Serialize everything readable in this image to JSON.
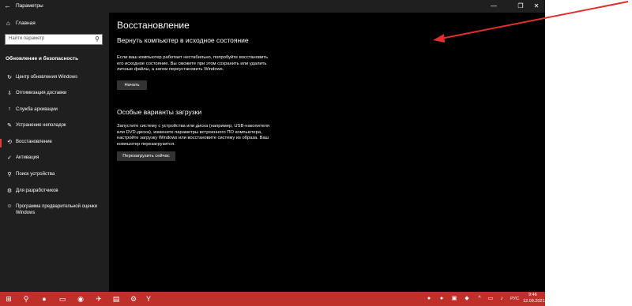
{
  "window": {
    "title": "Параметры",
    "back_glyph": "←",
    "min_glyph": "—",
    "max_glyph": "❐",
    "close_glyph": "✕"
  },
  "sidebar": {
    "home_label": "Главная",
    "search_placeholder": "Найти параметр",
    "section_title": "Обновление и безопасность",
    "items": [
      {
        "label": "Центр обновления Windows",
        "icon": "sync-icon",
        "glyph": "↻"
      },
      {
        "label": "Оптимизация доставки",
        "icon": "delivery-icon",
        "glyph": "⇩"
      },
      {
        "label": "Служба архивации",
        "icon": "backup-icon",
        "glyph": "↑"
      },
      {
        "label": "Устранение неполадок",
        "icon": "wrench-icon",
        "glyph": "✎"
      },
      {
        "label": "Восстановление",
        "icon": "recovery-icon",
        "glyph": "⟲"
      },
      {
        "label": "Активация",
        "icon": "activation-icon",
        "glyph": "✓"
      },
      {
        "label": "Поиск устройства",
        "icon": "find-device-icon",
        "glyph": "⚲"
      },
      {
        "label": "Для разработчиков",
        "icon": "developer-icon",
        "glyph": "⚙"
      },
      {
        "label": "Программа предварительной оценки Windows",
        "icon": "insider-icon",
        "glyph": "☺"
      }
    ]
  },
  "main": {
    "page_title": "Восстановление",
    "reset": {
      "heading": "Вернуть компьютер в исходное состояние",
      "description": "Если ваш компьютер работает нестабильно, попробуйте восстановить его исходное состояние. Вы сможете при этом сохранить или удалить личные файлы, а затем переустановить Windows.",
      "button": "Начать"
    },
    "advanced": {
      "heading": "Особые варианты загрузки",
      "description": "Запустите систему с устройства или диска (например, USB-накопителя или DVD-диска), измените параметры встроенного ПО компьютера, настройте загрузку Windows или восстановите систему из образа. Ваш компьютер перезагрузится.",
      "button": "Перезагрузить сейчас"
    }
  },
  "taskbar": {
    "time": "9:46",
    "date": "12.09.2021",
    "language": "РУС"
  },
  "colors": {
    "window_bg": "#000000",
    "sidebar_bg": "#1f1f1f",
    "accent": "#d9433c",
    "taskbar_bg": "#c0302b",
    "annotation_arrow": "#e0302b"
  }
}
